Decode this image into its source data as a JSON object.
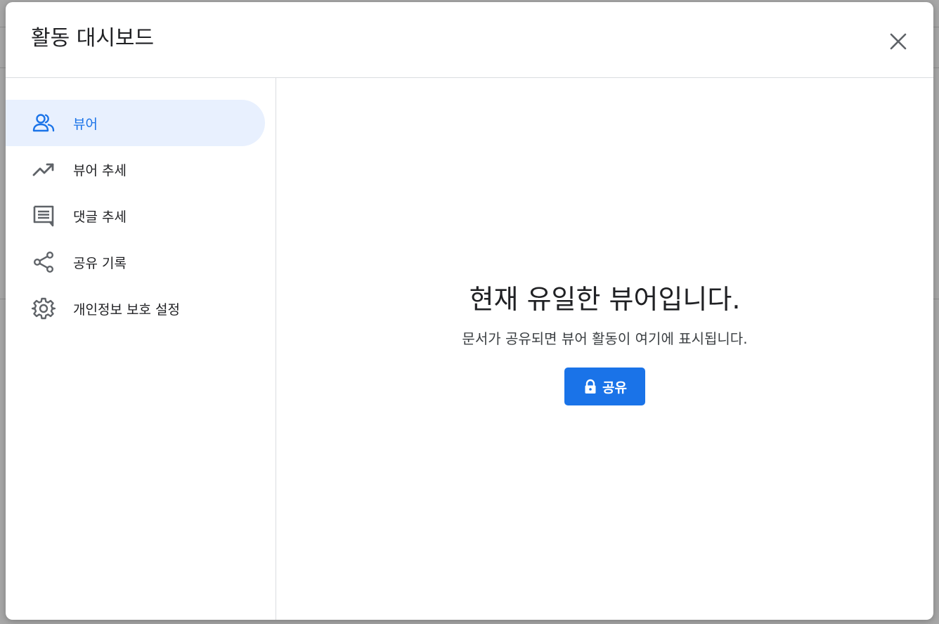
{
  "dialog": {
    "title": "활동 대시보드",
    "close_icon": "close-icon"
  },
  "sidebar": {
    "items": [
      {
        "label": "뷰어",
        "icon": "people-icon",
        "active": true
      },
      {
        "label": "뷰어 추세",
        "icon": "trending-up-icon",
        "active": false
      },
      {
        "label": "댓글 추세",
        "icon": "comment-icon",
        "active": false
      },
      {
        "label": "공유 기록",
        "icon": "share-icon",
        "active": false
      },
      {
        "label": "개인정보 보호 설정",
        "icon": "gear-icon",
        "active": false
      }
    ]
  },
  "main": {
    "title": "현재 유일한 뷰어입니다.",
    "subtitle": "문서가 공유되면 뷰어 활동이 여기에 표시됩니다.",
    "share_button": {
      "label": "공유",
      "icon": "lock-icon"
    }
  },
  "colors": {
    "accent": "#1a73e8",
    "active_bg": "#e8f0fe",
    "text": "#202124",
    "icon": "#5f6368",
    "divider": "#dadce0"
  }
}
